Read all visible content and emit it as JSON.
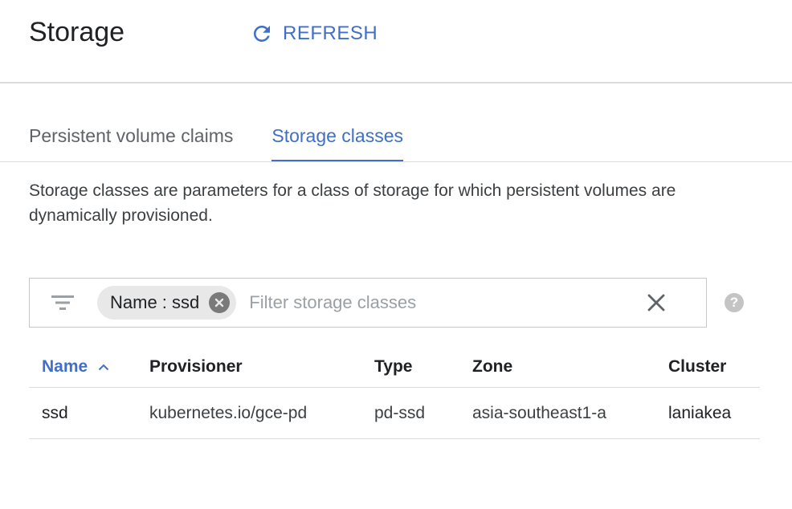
{
  "header": {
    "title": "Storage",
    "refresh_label": "REFRESH"
  },
  "tabs": [
    {
      "label": "Persistent volume claims",
      "active": false
    },
    {
      "label": "Storage classes",
      "active": true
    }
  ],
  "description": "Storage classes are parameters for a class of storage for which persistent volumes are dynamically provisioned.",
  "filter": {
    "icon": "filter-icon",
    "chip_label": "Name : ssd",
    "placeholder": "Filter storage classes",
    "value": "",
    "clear_icon": "close-icon",
    "help_icon": "help-icon",
    "help_glyph": "?"
  },
  "table": {
    "columns": [
      "Name",
      "Provisioner",
      "Type",
      "Zone",
      "Cluster"
    ],
    "sort_column": "Name",
    "sort_direction": "ascending",
    "rows": [
      {
        "name": "ssd",
        "provisioner": "kubernetes.io/gce-pd",
        "type": "pd-ssd",
        "zone": "asia-southeast1-a",
        "cluster": "laniakea"
      }
    ]
  },
  "colors": {
    "accent": "#3f6fc8",
    "divider": "#dadce0",
    "chip_bg": "#e8e8e8",
    "text_primary": "#202124",
    "text_secondary": "#5f6368"
  }
}
